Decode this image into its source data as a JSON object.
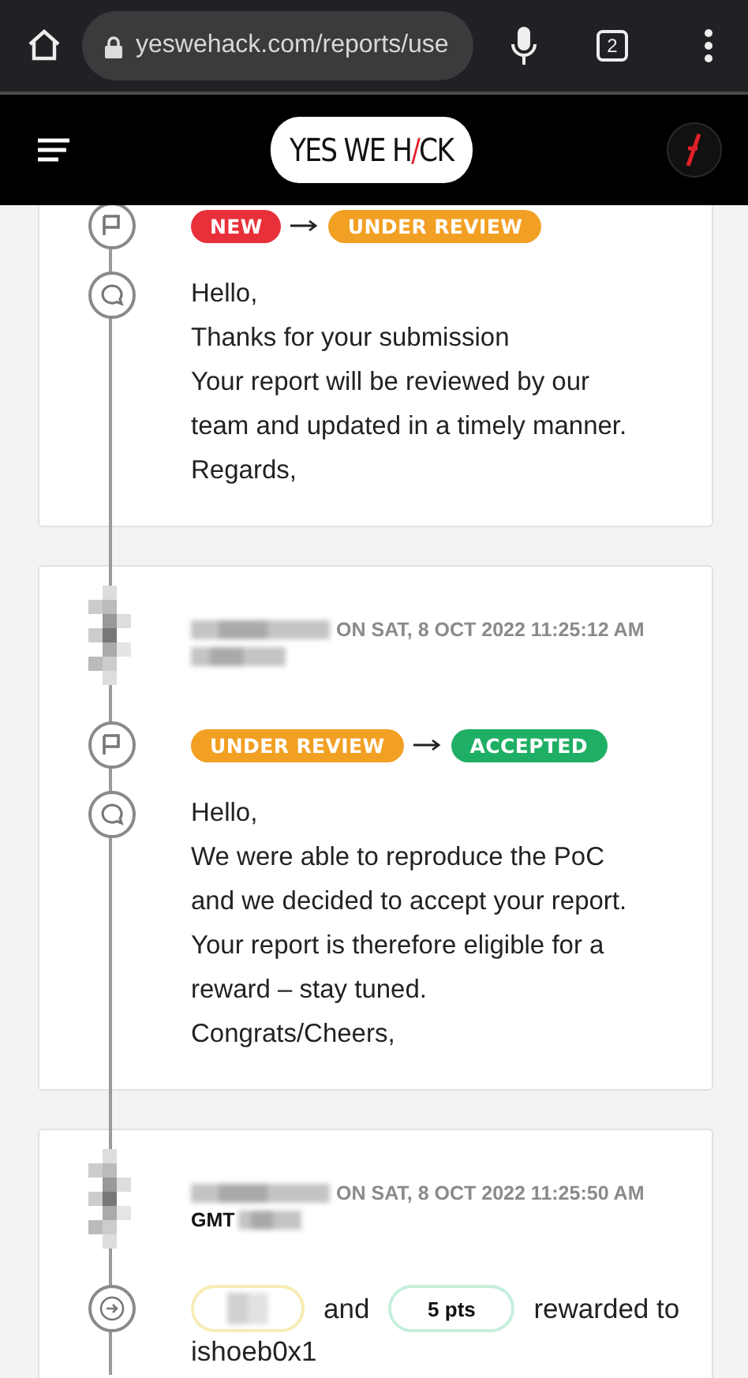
{
  "browser": {
    "url": "yeswehack.com/reports/use",
    "tab_count": "2"
  },
  "header": {
    "logo": [
      {
        "text": "YES WE H",
        "accent": false
      },
      {
        "text": "/",
        "accent": true
      },
      {
        "text": "CK",
        "accent": false
      }
    ]
  },
  "events": [
    {
      "items": [
        {
          "kind": "status",
          "from": {
            "label": "NEW",
            "color": "#e8303a"
          },
          "to": {
            "label": "UNDER REVIEW",
            "color": "#f2a024"
          }
        },
        {
          "kind": "comment",
          "lines": [
            "Hello,",
            "Thanks for your submission",
            "Your report will be reviewed by our",
            "team and updated in a timely manner.",
            "Regards,"
          ]
        }
      ]
    },
    {
      "items": [
        {
          "kind": "author",
          "meta": "ON **SAT, 8 OCT 2022 11:25:12 AM**"
        },
        {
          "kind": "status",
          "from": {
            "label": "UNDER REVIEW",
            "color": "#f2a024"
          },
          "to": {
            "label": "ACCEPTED",
            "color": "#1faf64"
          }
        },
        {
          "kind": "comment",
          "lines": [
            "Hello,",
            "We were able to reproduce the PoC",
            "and we decided to accept your report.",
            "Your report is therefore eligible for a",
            "reward – stay tuned.",
            "Congrats/Cheers,"
          ]
        }
      ]
    },
    {
      "items": [
        {
          "kind": "author",
          "meta": "ON **SAT, 8 OCT 2022 11:25:50 AM**",
          "timezone": "GMT"
        },
        {
          "kind": "reward",
          "joiner": "and",
          "points": "5 pts",
          "suffix": "rewarded to",
          "user": "ishoeb0x1"
        }
      ]
    }
  ]
}
